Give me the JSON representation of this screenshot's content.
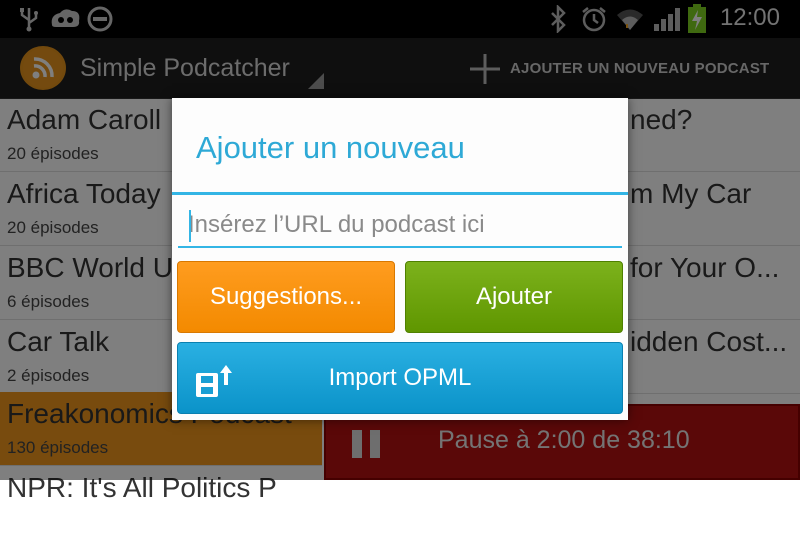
{
  "status_bar": {
    "time": "12:00",
    "icons": [
      "usb-icon",
      "voicemail-icon",
      "no-sim-icon",
      "bluetooth-icon",
      "alarm-icon",
      "wifi-icon",
      "signal-icon",
      "battery-charging-icon"
    ]
  },
  "action_bar": {
    "app_title": "Simple Podcatcher",
    "add_podcast_label": "AJOUTER UN NOUVEAU PODCAST"
  },
  "podcasts": [
    {
      "title": "Adam Caroll",
      "episodes": "20 épisodes",
      "right_fragment": "ned?"
    },
    {
      "title": "Africa Today",
      "episodes": "20 épisodes",
      "right_fragment": "m My Car"
    },
    {
      "title": "BBC World U",
      "episodes": "6 épisodes",
      "right_fragment": "for Your O..."
    },
    {
      "title": "Car Talk",
      "episodes": "2 épisodes",
      "right_fragment": "idden Cost..."
    },
    {
      "title": "Freakonomics Podcast",
      "episodes": "130 épisodes",
      "right_fragment": ""
    },
    {
      "title": "NPR: It's All Politics P",
      "episodes": "",
      "right_fragment": ""
    }
  ],
  "player": {
    "status_text": "Pause à 2:00 de 38:10"
  },
  "dialog": {
    "title": "Ajouter un nouveau",
    "url_placeholder": "Insérez l’URL du podcast ici",
    "url_value": "",
    "suggestions_label": "Suggestions...",
    "add_label": "Ajouter",
    "import_label": "Import OPML"
  },
  "colors": {
    "accent_blue": "#33b5e5",
    "orange": "#f38a00",
    "green": "#6aa40c",
    "player_red": "#b51010",
    "highlight_row": "#f0961c"
  }
}
